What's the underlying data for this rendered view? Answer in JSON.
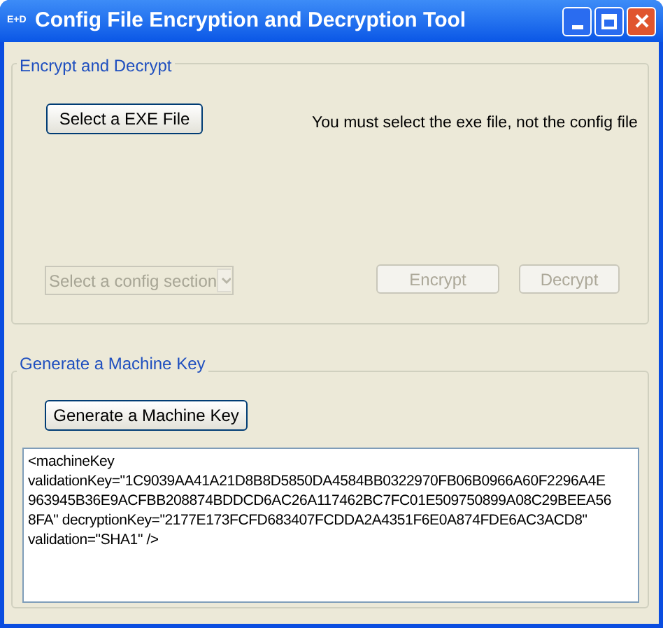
{
  "window": {
    "title": "Config File Encryption and Decryption Tool",
    "icon_text": "E+D"
  },
  "encrypt_group": {
    "title": "Encrypt and Decrypt",
    "select_button": {
      "label": "Select a EXE File",
      "disabled": false
    },
    "hint": "You must select the exe file, not the config file",
    "section_combo": {
      "placeholder": "Select a config section",
      "disabled": true
    },
    "buttons": [
      {
        "label": "Encrypt",
        "disabled": true
      },
      {
        "label": "Decrypt",
        "disabled": true
      }
    ]
  },
  "machine_key_group": {
    "title": "Generate a Machine Key",
    "generate_button": {
      "label": "Generate a Machine Key",
      "disabled": false
    },
    "output_lines": [
      "<machineKey",
      "validationKey=\"1C9039AA41A21D8B8D5850DA4584BB0322970FB06B0966A60F2296A4E",
      "963945B36E9ACFBB208874BDDCD6AC26A117462BC7FC01E509750899A08C29BEEA56",
      "8FA\" decryptionKey=\"2177E173FCFD683407FCDDA2A4351F6E0A874FDE6AC3ACD8\"",
      "validation=\"SHA1\" />"
    ]
  }
}
